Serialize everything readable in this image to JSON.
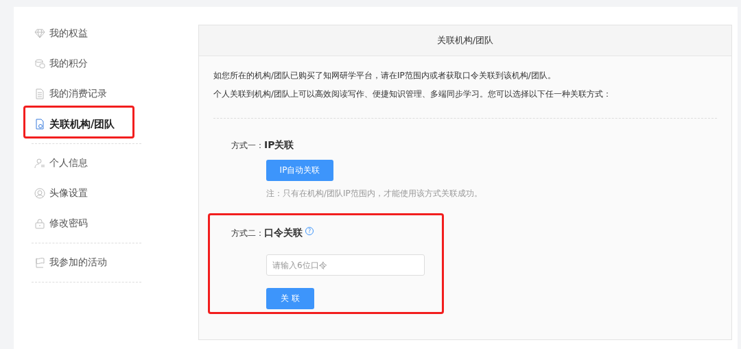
{
  "sidebar": {
    "groups": [
      {
        "items": [
          {
            "label": "我的权益",
            "selected": false,
            "highlighted": false
          },
          {
            "label": "我的积分",
            "selected": false,
            "highlighted": false
          },
          {
            "label": "我的消费记录",
            "selected": false,
            "highlighted": false
          },
          {
            "label": "关联机构/团队",
            "selected": true,
            "highlighted": true
          }
        ]
      },
      {
        "items": [
          {
            "label": "个人信息",
            "selected": false,
            "highlighted": false
          },
          {
            "label": "头像设置",
            "selected": false,
            "highlighted": false
          },
          {
            "label": "修改密码",
            "selected": false,
            "highlighted": false
          }
        ]
      },
      {
        "items": [
          {
            "label": "我参加的活动",
            "selected": false,
            "highlighted": false
          }
        ]
      }
    ]
  },
  "panel": {
    "title": "关联机构/团队",
    "intro": [
      "如您所在的机构/团队已购买了知网研学平台，请在IP范围内或者获取口令关联到该机构/团队。",
      "个人关联到机构/团队上可以高效阅读写作、便捷知识管理、多端同步学习。您可以选择以下任一种关联方式："
    ],
    "methods": [
      {
        "kind": "ip",
        "prefix": "方式一：",
        "name": "IP关联",
        "highlighted": false,
        "button": "IP自动关联",
        "note": "注：只有在机构/团队IP范围内，才能使用该方式关联成功。"
      },
      {
        "kind": "code",
        "prefix": "方式二：",
        "name": "口令关联",
        "highlighted": true,
        "help": "?",
        "placeholder": "请输入6位口令",
        "button": "关 联"
      }
    ]
  }
}
